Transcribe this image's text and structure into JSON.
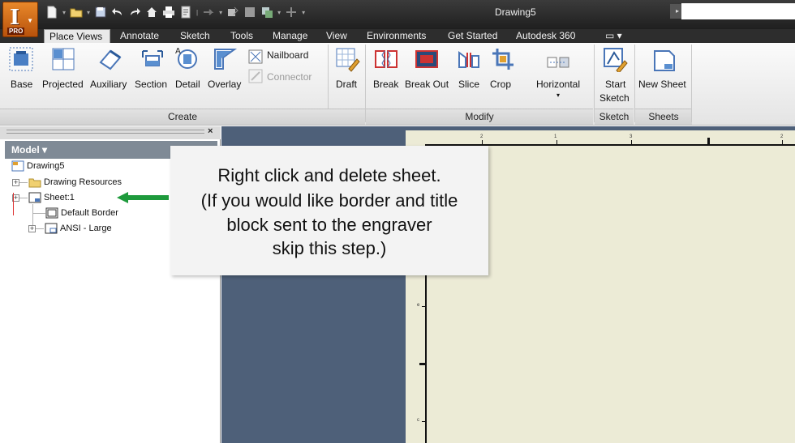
{
  "window": {
    "title": "Drawing5",
    "app_badge": "PRO"
  },
  "quick_access": {
    "icons": [
      "new-icon",
      "open-icon",
      "save-icon",
      "undo-icon",
      "redo-icon",
      "home-icon",
      "print-icon",
      "properties-icon"
    ]
  },
  "tabs": [
    {
      "label": "Place Views",
      "active": true
    },
    {
      "label": "Annotate"
    },
    {
      "label": "Sketch"
    },
    {
      "label": "Tools"
    },
    {
      "label": "Manage"
    },
    {
      "label": "View"
    },
    {
      "label": "Environments"
    },
    {
      "label": "Get Started"
    },
    {
      "label": "Autodesk 360"
    }
  ],
  "ribbon": {
    "create": {
      "group_label": "Create",
      "buttons": {
        "base": "Base",
        "projected": "Projected",
        "auxiliary": "Auxiliary",
        "section": "Section",
        "detail": "Detail",
        "overlay": "Overlay",
        "nailboard": "Nailboard",
        "connector": "Connector",
        "draft": "Draft"
      }
    },
    "modify": {
      "group_label": "Modify",
      "buttons": {
        "break": "Break",
        "break_out": "Break Out",
        "slice": "Slice",
        "crop": "Crop",
        "horizontal": "Horizontal"
      }
    },
    "sketch": {
      "group_label": "Sketch",
      "start_sketch_line1": "Start",
      "start_sketch_line2": "Sketch"
    },
    "sheets": {
      "group_label": "Sheets",
      "new_sheet": "New Sheet"
    }
  },
  "browser": {
    "header": "Model ▾",
    "close_glyph": "×",
    "tree": {
      "root": "Drawing5",
      "resources": "Drawing Resources",
      "sheet": "Sheet:1",
      "border": "Default Border",
      "titleblock": "ANSI - Large"
    }
  },
  "callout": {
    "lines": [
      "Right click and delete sheet.",
      "(If you would like border and title",
      "block sent to the engraver",
      "skip this step.)"
    ],
    "arrow_color": "#1e9a3c"
  },
  "canvas": {
    "background_color": "#4e6079",
    "sheet_color": "#ecebd6",
    "top_ticks": [
      "2",
      "1",
      "3",
      "2"
    ],
    "left_ticks": [
      "e",
      "4",
      "c"
    ]
  }
}
